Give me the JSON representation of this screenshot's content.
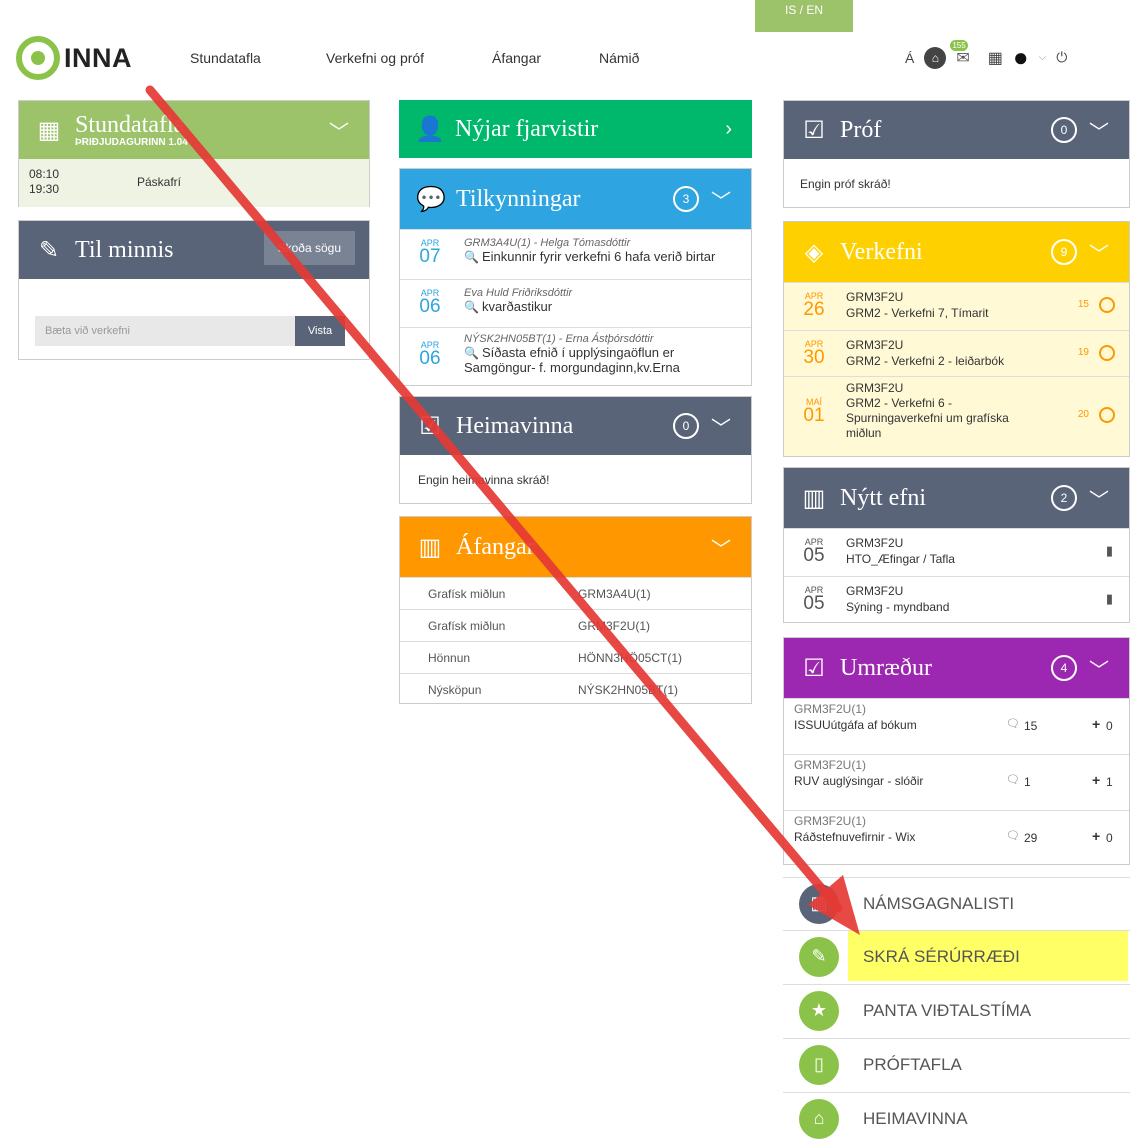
{
  "topbar": {
    "lang": "IS / EN",
    "logo": "INNA",
    "nav": [
      "Stundatafla",
      "Verkefni og próf",
      "Áfangar",
      "Námið"
    ],
    "icons": {
      "font_label": "Á",
      "badge": "155",
      "home": "home-icon",
      "chat": "chat-icon",
      "calendar": "calendar-icon",
      "user": "user-icon",
      "power": "power-icon"
    }
  },
  "stundatafla": {
    "title": "Stundatafla",
    "subtitle": "ÞRIÐJUDAGURINN 1.04",
    "time_start": "08:10",
    "time_end": "19:30",
    "event": "Páskafrí"
  },
  "minnis": {
    "title": "Til minnis",
    "history_button": "Skoða sögu",
    "input_placeholder": "Bæta við verkefni",
    "save_button": "Vista"
  },
  "fjarvistir": {
    "title": "Nýjar fjarvistir"
  },
  "tilkynningar": {
    "title": "Tilkynningar",
    "count": "3",
    "items": [
      {
        "month": "APR",
        "day": "07",
        "meta": "GRM3A4U(1) - Helga Tómasdóttir",
        "text": "Einkunnir fyrir verkefni 6 hafa verið birtar"
      },
      {
        "month": "APR",
        "day": "06",
        "meta": "Eva Huld Friðriksdóttir",
        "text": "kvarðastikur"
      },
      {
        "month": "APR",
        "day": "06",
        "meta": "NÝSK2HN05BT(1) - Erna Ástþórsdóttir",
        "text": "Síðasta efnið í upplýsingaöflun er",
        "text2": "Samgöngur- f. morgundaginn,kv.Erna"
      }
    ]
  },
  "heimavinna": {
    "title": "Heimavinna",
    "count": "0",
    "empty": "Engin heimavinna skráð!"
  },
  "afangar": {
    "title": "Áfangar",
    "rows": [
      {
        "name": "Grafísk miðlun",
        "code": "GRM3A4U(1)"
      },
      {
        "name": "Grafísk miðlun",
        "code": "GRM3F2U(1)"
      },
      {
        "name": "Hönnun",
        "code": "HÖNN3HÖ05CT(1)"
      },
      {
        "name": "Nýsköpun",
        "code": "NÝSK2HN05BT(1)"
      }
    ]
  },
  "prof": {
    "title": "Próf",
    "count": "0",
    "empty": "Engin próf skráð!"
  },
  "verkefni": {
    "title": "Verkefni",
    "count": "9",
    "items": [
      {
        "month": "APR",
        "day": "26",
        "course": "GRM3F2U",
        "text": "GRM2 - Verkefni 7, Tímarit",
        "num": "15"
      },
      {
        "month": "APR",
        "day": "30",
        "course": "GRM3F2U",
        "text": "GRM2 - Verkefni 2 - leiðarbók",
        "num": "19"
      },
      {
        "month": "MAÍ",
        "day": "01",
        "course": "GRM3F2U",
        "text": "GRM2 - Verkefni 6 -",
        "text2": "Spurningaverkefni um grafíska",
        "text3": "miðlun",
        "num": "20"
      }
    ]
  },
  "nyttefni": {
    "title": "Nýtt efni",
    "count": "2",
    "items": [
      {
        "month": "APR",
        "day": "05",
        "course": "GRM3F2U",
        "text": "HTO_Æfingar / Tafla"
      },
      {
        "month": "APR",
        "day": "05",
        "course": "GRM3F2U",
        "text": "Sýning - myndband"
      }
    ]
  },
  "umraedur": {
    "title": "Umræður",
    "count": "4",
    "items": [
      {
        "course": "GRM3F2U(1)",
        "text": "ISSUUútgáfa af bókum",
        "comments": "15",
        "plus": "0"
      },
      {
        "course": "GRM3F2U(1)",
        "text": "RUV auglýsingar - slóðir",
        "comments": "1",
        "plus": "1"
      },
      {
        "course": "GRM3F2U(1)",
        "text": "Ráðstefnuvefirnir - Wix",
        "comments": "29",
        "plus": "0"
      }
    ]
  },
  "quicklinks": [
    "NÁMSGAGNALISTI",
    "SKRÁ SÉRÚRRÆÐI",
    "PANTA VIÐTALSTÍMA",
    "PRÓFTAFLA",
    "HEIMAVINNA"
  ],
  "colors": {
    "accent_green": "#9cc36a",
    "arrow": "#e53935",
    "highlight": "#ffff66"
  }
}
